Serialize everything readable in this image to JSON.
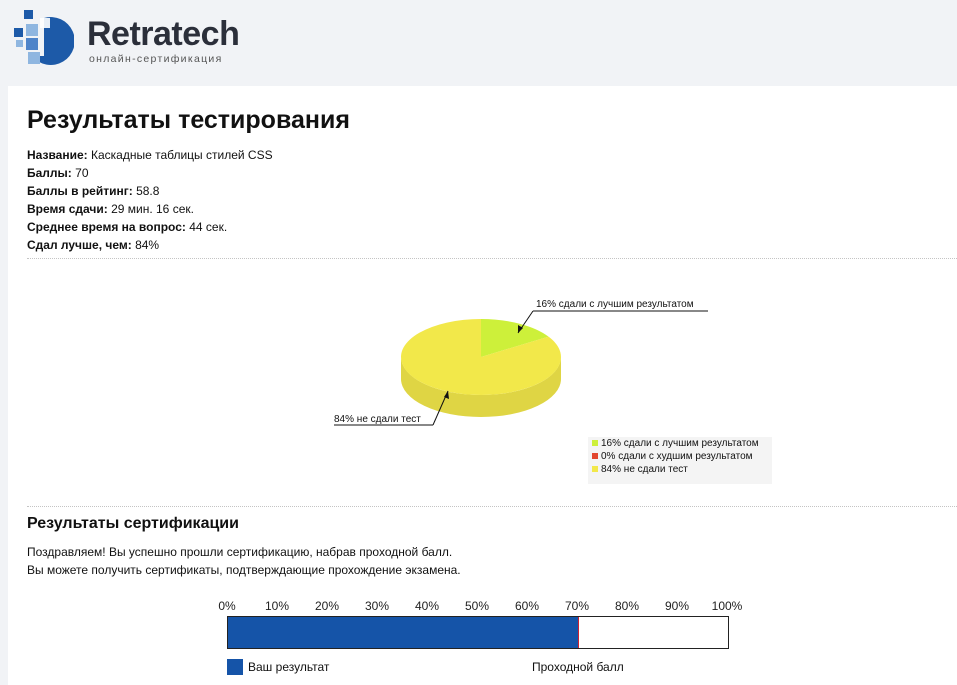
{
  "header": {
    "brand": "Retratech",
    "tagline": "онлайн-сертификация",
    "logo_icon": "retratech-logo-icon"
  },
  "page": {
    "title": "Результаты тестирования"
  },
  "test_info": {
    "name_label": "Название:",
    "name_value": "Каскадные таблицы стилей CSS",
    "score_label": "Баллы:",
    "score_value": "70",
    "rating_label": "Баллы в рейтинг:",
    "rating_value": "58.8",
    "time_label": "Время сдачи:",
    "time_value": "29 мин. 16 сек.",
    "avg_label": "Среднее время на вопрос:",
    "avg_value": "44 сек.",
    "better_label": "Сдал лучше, чем:",
    "better_value": "84%"
  },
  "chart_data": {
    "type": "pie",
    "title": "",
    "series": [
      {
        "name": "16% сдали с лучшим результатом",
        "value": 16,
        "color": "#cdf03a"
      },
      {
        "name": "0% сдали с худшим результатом",
        "value": 0,
        "color": "#e2472f"
      },
      {
        "name": "84% не сдали тест",
        "value": 84,
        "color": "#f2e84a"
      }
    ],
    "callouts": [
      "16% сдали с лучшим результатом",
      "84% не сдали тест"
    ],
    "legend_position": "bottom-right"
  },
  "certification": {
    "title": "Результаты сертификации",
    "message_line1": "Поздравляем! Вы успешно прошли сертификацию, набрав проходной балл.",
    "message_line2": "Вы можете получить сертификаты, подтверждающие прохождение экзамена.",
    "scale": [
      "0%",
      "10%",
      "20%",
      "30%",
      "40%",
      "50%",
      "60%",
      "70%",
      "80%",
      "90%",
      "100%"
    ],
    "result_percent": 70,
    "your_result_label": "Ваш результат",
    "passing_label": "Проходной балл",
    "bar_color": "#1554a8"
  }
}
